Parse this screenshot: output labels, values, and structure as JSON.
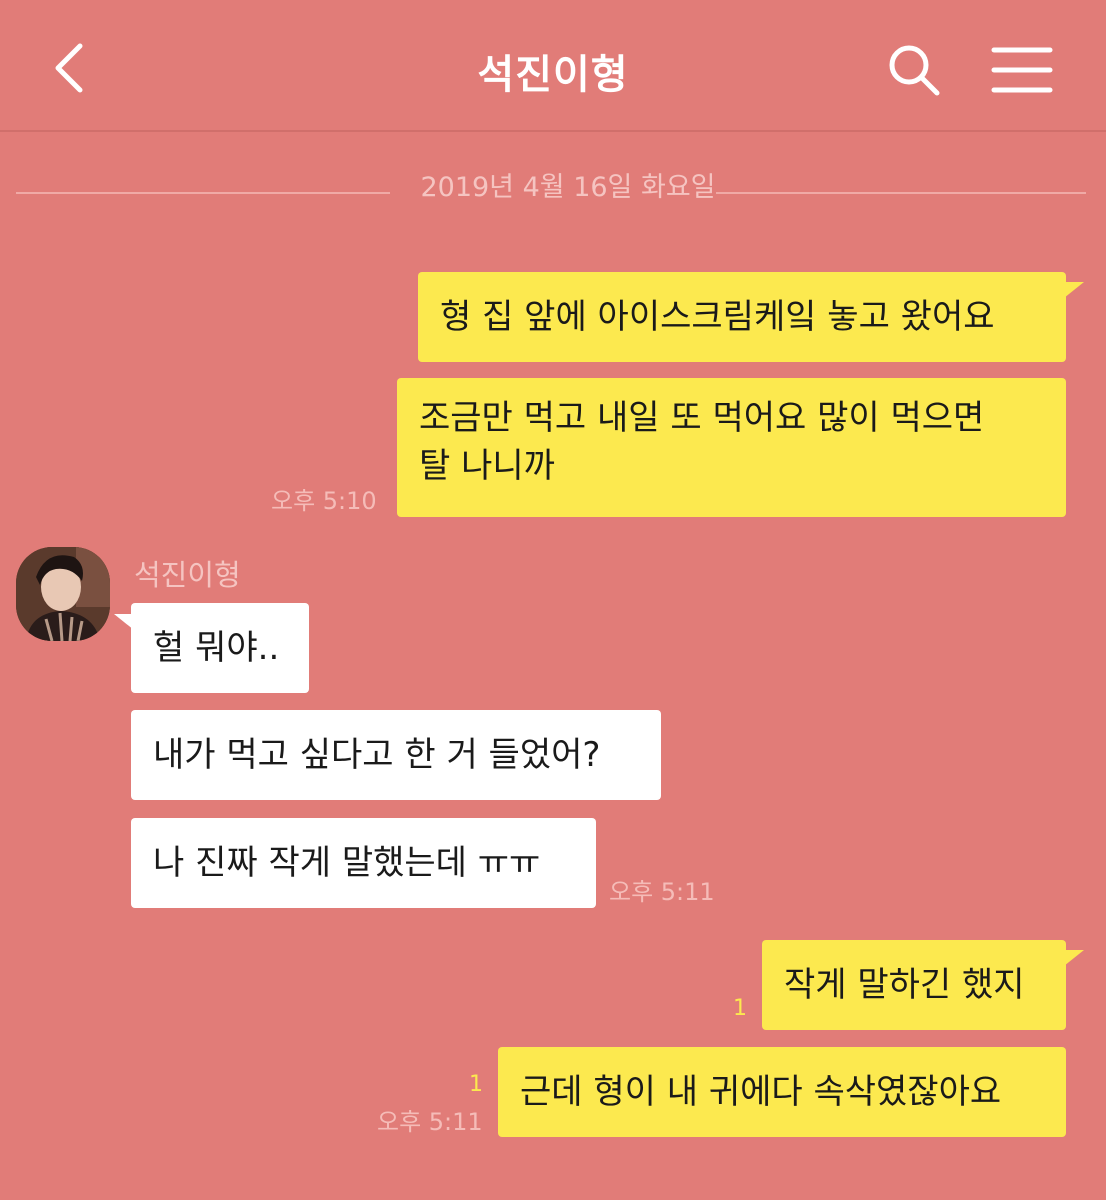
{
  "header": {
    "title": "석진이형"
  },
  "date_separator": "2019년 4월 16일 화요일",
  "messages": {
    "m1": "형 집 앞에 아이스크림케잌 놓고 왔어요",
    "m2_line1": "조금만 먹고 내일 또 먹어요 많이 먹으면",
    "m2_line2": "탈 나니까",
    "time1": "오후 5:10",
    "sender": "석진이형",
    "t1": "헐 뭐야..",
    "t2": "내가 먹고 싶다고 한 거 들었어?",
    "t3": "나 진짜 작게 말했는데 ㅠㅠ",
    "time2": "오후 5:11",
    "m3": "작게 말하긴 했지",
    "m3_unread": "1",
    "m4": "근데 형이 내 귀에다 속삭였잖아요",
    "m4_unread": "1",
    "time3": "오후 5:11"
  },
  "colors": {
    "background": "#e17c78",
    "my_bubble": "#fce94f",
    "their_bubble": "#ffffff"
  }
}
